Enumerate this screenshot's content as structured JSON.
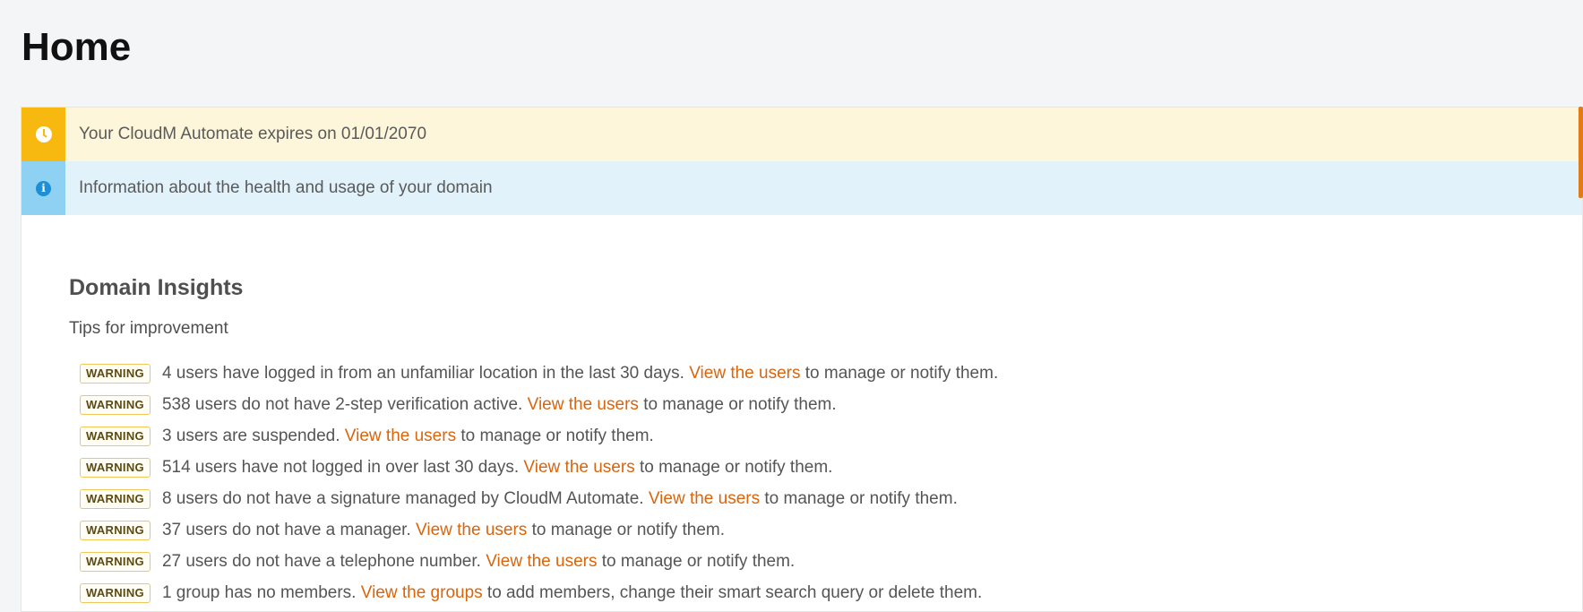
{
  "page": {
    "title": "Home"
  },
  "alerts": {
    "expiry": {
      "icon": "clock-icon",
      "text": "Your CloudM Automate expires on 01/01/2070"
    },
    "info": {
      "icon": "info-icon",
      "text": "Information about the health and usage of your domain"
    }
  },
  "insights": {
    "title": "Domain Insights",
    "subtitle": "Tips for improvement",
    "tips": [
      {
        "badge": "WARNING",
        "text": "4 users have logged in from an unfamiliar location in the last 30 days.",
        "link": "View the users",
        "after": "to manage or notify them."
      },
      {
        "badge": "WARNING",
        "text": "538 users do not have 2-step verification active.",
        "link": "View the users",
        "after": "to manage or notify them."
      },
      {
        "badge": "WARNING",
        "text": "3 users are suspended.",
        "link": "View the users",
        "after": "to manage or notify them."
      },
      {
        "badge": "WARNING",
        "text": "514 users have not logged in over last 30 days.",
        "link": "View the users",
        "after": "to manage or notify them."
      },
      {
        "badge": "WARNING",
        "text": "8 users do not have a signature managed by CloudM Automate.",
        "link": "View the users",
        "after": "to manage or notify them."
      },
      {
        "badge": "WARNING",
        "text": "37 users do not have a manager.",
        "link": "View the users",
        "after": "to manage or notify them."
      },
      {
        "badge": "WARNING",
        "text": "27 users do not have a telephone number.",
        "link": "View the users",
        "after": "to manage or notify them."
      },
      {
        "badge": "WARNING",
        "text": "1 group has no members.",
        "link": "View the groups",
        "after": "to add members, change their smart search query or delete them."
      }
    ]
  },
  "colors": {
    "accent_link": "#d9650d",
    "warning_alert_bg": "#fdf6da",
    "warning_icon_bg": "#f7b90f",
    "info_alert_bg": "#e2f2fb",
    "info_icon_bg": "#8fd1f2",
    "badge_border": "#f2c65a"
  }
}
